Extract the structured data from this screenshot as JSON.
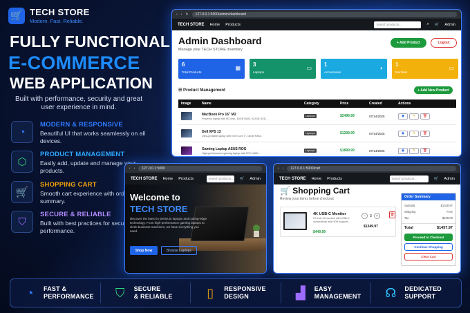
{
  "brand": {
    "name": "TECH STORE",
    "tagline": "Modern. Fast. Reliable.",
    "logo_icon": "cart-icon"
  },
  "headline": {
    "line1": "FULLY FUNCTIONAL",
    "line2": "E-COMMERCE",
    "line3": "WEB APPLICATION",
    "subtext": "Built with performance, security and great user experience in mind."
  },
  "features": [
    {
      "title": "MODERN & RESPONSIVE",
      "desc": "Beautiful UI that works seamlessly on all devices.",
      "icon": "speedometer-icon",
      "color": "#2f7bff"
    },
    {
      "title": "PRODUCT MANAGEMENT",
      "desc": "Easily add, update and manage your products.",
      "icon": "cube-icon",
      "color": "#2fd37a"
    },
    {
      "title": "SHOPPING CART",
      "desc": "Smooth cart experience with order summary.",
      "icon": "cart-icon",
      "color": "#f2a20c"
    },
    {
      "title": "SECURE & RELIABLE",
      "desc": "Built with best practices for security and performance.",
      "icon": "shield-icon",
      "color": "#9c6bff"
    }
  ],
  "bottom_bar": [
    {
      "line1": "FAST &",
      "line2": "PERFORMANCE",
      "icon": "speedometer-icon",
      "color": "#2f7bff"
    },
    {
      "line1": "SECURE",
      "line2": "& RELIABLE",
      "icon": "shield-check-icon",
      "color": "#2fd37a"
    },
    {
      "line1": "RESPONSIVE",
      "line2": "DESIGN",
      "icon": "phone-icon",
      "color": "#f2a20c"
    },
    {
      "line1": "EASY",
      "line2": "MANAGEMENT",
      "icon": "chart-icon",
      "color": "#9c6bff"
    },
    {
      "line1": "DEDICATED",
      "line2": "SUPPORT",
      "icon": "headset-icon",
      "color": "#2fc6ff"
    }
  ],
  "admin": {
    "url": "127.0.0.1:5000/admin/dashboard",
    "nav_logo": "TECH STORE",
    "nav_home": "Home",
    "nav_products": "Products",
    "search_placeholder": "Search products...",
    "user": "Admin",
    "title": "Admin Dashboard",
    "subtitle": "Manage your TECH STORE inventory",
    "add_product": "+ Add Product",
    "logout": "Logout",
    "stats": [
      {
        "num": "6",
        "label": "Total Products",
        "color": "#1f64e6"
      },
      {
        "num": "3",
        "label": "Laptops",
        "color": "#14936a"
      },
      {
        "num": "1",
        "label": "Accessories",
        "color": "#1aa9e0"
      },
      {
        "num": "1",
        "label": "Monitors",
        "color": "#f3b10c"
      }
    ],
    "pm_title": "Product Management",
    "add_new": "+ Add New Product",
    "columns": [
      "Image",
      "Name",
      "Category",
      "Price",
      "Created",
      "Actions"
    ],
    "rows": [
      {
        "name": "MacBook Pro 16\" M2",
        "desc": "Powerful laptop with M2 chip, 16GB RAM, 512GB SSD...",
        "category": "Laptops",
        "price": "$2499.99",
        "created": "07/14/2025"
      },
      {
        "name": "Dell XPS 13",
        "desc": "Ultra-portable laptop with Intel Core i7, 16GB RAM...",
        "category": "Laptops",
        "price": "$1299.99",
        "created": "07/14/2025"
      },
      {
        "name": "Gaming Laptop ASUS ROG",
        "desc": "High-performance gaming laptop with RTX 4060...",
        "category": "Laptops",
        "price": "$1899.99",
        "created": "07/14/2025"
      }
    ]
  },
  "home": {
    "url": "127.0.0.1:5000",
    "nav_logo": "TECH STORE",
    "nav_home": "Home",
    "nav_products": "Products",
    "search_placeholder": "Search products...",
    "user": "Admin",
    "title1": "Welcome to",
    "title2": "TECH STORE",
    "para": "Discover the latest in premium laptops and cutting-edge technology. From high-performance gaming laptops to sleek business machines, we have everything you need.",
    "shop_now": "Shop Now",
    "browse": "Browse Laptops"
  },
  "cart": {
    "url": "127.0.0.1:5000/cart",
    "nav_logo": "TECH STORE",
    "nav_home": "Home",
    "nav_products": "Products",
    "search_placeholder": "Search products...",
    "user": "Admin",
    "title": "Shopping Cart",
    "subtitle": "Review your items before checkout",
    "item_name": "4K USB-C Monitor",
    "item_desc": "27-inch 4K monitor with USB-C connectivity and HDR support...",
    "item_price": "$449.99",
    "qty": "3",
    "item_total": "$1349.97",
    "summary_title": "Order Summary",
    "summary": [
      {
        "label": "Subtotal",
        "value": "$1349.97"
      },
      {
        "label": "Shipping",
        "value": "Free"
      },
      {
        "label": "Tax",
        "value": "$108.00"
      }
    ],
    "total_label": "Total",
    "total_value": "$1457.97",
    "checkout": "Proceed to Checkout",
    "continue": "Continue Shopping",
    "clear": "Clear Cart"
  }
}
